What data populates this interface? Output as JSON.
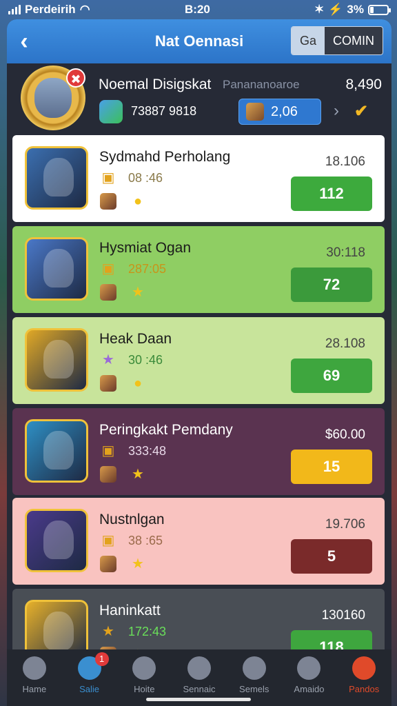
{
  "status": {
    "carrier": "Perdeirih",
    "time": "B:20",
    "battery": "3%"
  },
  "header": {
    "back_icon": "chevron-left-icon",
    "title": "Nat Oennasi",
    "segment_left": "Ga",
    "segment_right": "COMIN",
    "accent": "#2c74c8"
  },
  "profile": {
    "name": "Noemal Disigskat",
    "subtitle": "Panananoaroe",
    "score": "8,490",
    "id": "73887 9818",
    "coins": "2,06"
  },
  "cards": [
    {
      "title": "Sydmahd Perholang",
      "value": "08 :46",
      "score": "18.106",
      "button": "112",
      "bg": "#ffffff",
      "btn_color": "#3daa3d",
      "value_color": "#8a7a4a",
      "thumb": "#3b6fb0"
    },
    {
      "title": "Hysmiat Ogan",
      "value": "287:05",
      "score": "30:118",
      "button": "72",
      "bg": "#8fce63",
      "btn_color": "#3b9a3b",
      "value_color": "#c8941a",
      "thumb": "#4a78c8"
    },
    {
      "title": "Heak Daan",
      "value": "30 :46",
      "score": "28.108",
      "button": "69",
      "bg": "#c8e49b",
      "btn_color": "#3ea63e",
      "value_color": "#3a8a3a",
      "thumb": "#e0a826"
    },
    {
      "title": "Peringkakt Pemdany",
      "value": "333:48",
      "score": "$60.00",
      "button": "15",
      "bg": "#5a3350",
      "btn_color": "#f2b81a",
      "value_color": "#e8d8e8",
      "thumb": "#2e8fc4"
    },
    {
      "title": "Nustnlgan",
      "value": "38 :65",
      "score": "19.706",
      "button": "5",
      "bg": "#f9c3c0",
      "btn_color": "#7a2a2a",
      "value_color": "#9a6a4a",
      "thumb": "#4a3a8a"
    },
    {
      "title": "Haninkatt",
      "value": "172:43",
      "score": "130160",
      "button": "118",
      "bg": "#494e55",
      "btn_color": "#3ea63e",
      "value_color": "#6adf5a",
      "thumb": "#e6b02a"
    }
  ],
  "nav": [
    {
      "label": "Hame",
      "icon": "home-icon"
    },
    {
      "label": "Salie",
      "icon": "chat-icon",
      "badge": "1"
    },
    {
      "label": "Hoite",
      "icon": "list-icon"
    },
    {
      "label": "Sennaic",
      "icon": "search-icon"
    },
    {
      "label": "Semels",
      "icon": "joystick-icon"
    },
    {
      "label": "Amaido",
      "icon": "camera-icon"
    },
    {
      "label": "Pandos",
      "icon": "profile-icon",
      "active": true
    }
  ]
}
